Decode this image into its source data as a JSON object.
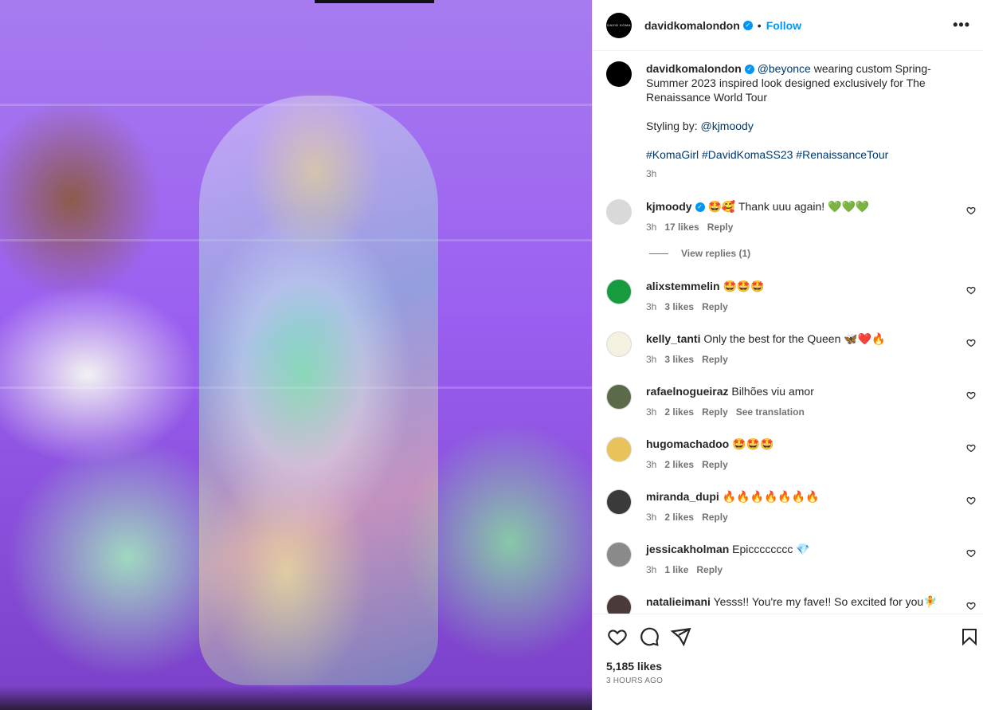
{
  "post": {
    "username": "davidkomalondon",
    "verified_mark": "✓",
    "follow_label": "Follow",
    "separator": "•",
    "more_label": "•••",
    "avatar_text": "DAVID KOMA"
  },
  "caption": {
    "mention": "@beyonce",
    "text": " wearing custom Spring-Summer 2023 inspired look designed exclusively for The Renaissance World Tour",
    "styling_prefix": "Styling by: ",
    "styling_mention": "@kjmoody",
    "hashtags": "#KomaGirl #DavidKomaSS23 #RenaissanceTour",
    "time": "3h"
  },
  "comments": [
    {
      "user": "kjmoody",
      "verified": true,
      "text": "🤩🥰 Thank uuu again! 💚💚💚",
      "time": "3h",
      "likes": "17 likes",
      "reply": "Reply",
      "translate": "",
      "avatar_color": "#d9d9d9"
    },
    {
      "user": "alixstemmelin",
      "verified": false,
      "text": "🤩🤩🤩",
      "time": "3h",
      "likes": "3 likes",
      "reply": "Reply",
      "translate": "",
      "avatar_color": "#169b3f"
    },
    {
      "user": "kelly_tanti",
      "verified": false,
      "text": "Only the best for the Queen 🦋❤️🔥",
      "time": "3h",
      "likes": "3 likes",
      "reply": "Reply",
      "translate": "",
      "avatar_color": "#f4f1e1"
    },
    {
      "user": "rafaelnogueiraz",
      "verified": false,
      "text": "Bilhões viu amor",
      "time": "3h",
      "likes": "2 likes",
      "reply": "Reply",
      "translate": "See translation",
      "avatar_color": "#5b6b4a"
    },
    {
      "user": "hugomachadoo",
      "verified": false,
      "text": "🤩🤩🤩",
      "time": "3h",
      "likes": "2 likes",
      "reply": "Reply",
      "translate": "",
      "avatar_color": "#e8c25a"
    },
    {
      "user": "miranda_dupi",
      "verified": false,
      "text": "🔥🔥🔥🔥🔥🔥🔥",
      "time": "3h",
      "likes": "2 likes",
      "reply": "Reply",
      "translate": "",
      "avatar_color": "#3a3a3a"
    },
    {
      "user": "jessicakholman",
      "verified": false,
      "text": "Epicccccccc 💎",
      "time": "3h",
      "likes": "1 like",
      "reply": "Reply",
      "translate": "",
      "avatar_color": "#8a8a8a"
    },
    {
      "user": "natalieimani",
      "verified": false,
      "text": "Yesss!! You're my fave!! So excited for you🧚",
      "time": "",
      "likes": "",
      "reply": "",
      "translate": "",
      "avatar_color": "#4a3a3a"
    }
  ],
  "view_replies": "View replies (1)",
  "stats": {
    "likes": "5,185 likes",
    "posted": "3 HOURS AGO"
  },
  "icons": [
    "heart-icon",
    "comment-icon",
    "share-icon",
    "bookmark-icon"
  ]
}
